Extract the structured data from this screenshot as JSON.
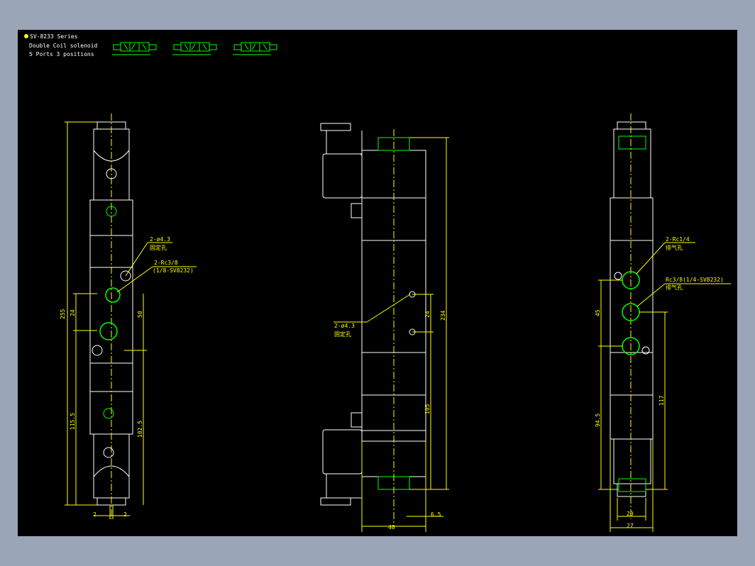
{
  "header": {
    "title": "SV-8233 Series",
    "line2": "Double Coil solenoid",
    "line3": "5 Ports 3 positions",
    "bullet_color": "#ffff00"
  },
  "colors": {
    "body_outline": "#ffffff",
    "dimension": "#ffff00",
    "port_circle": "#00ff00",
    "background": "#000000",
    "frame": "#9aa6b8"
  },
  "left_view": {
    "callout_mount": "2-ø4.3",
    "callout_mount_cn": "固定孔",
    "callout_port": "2-Rc3/8",
    "callout_port_sub": "(1/8-SV8232)",
    "dims": {
      "overall": "255",
      "d24": "24",
      "d50": "50",
      "d115": "115.5",
      "d102": "102.5",
      "d2a": "2",
      "d2b": "2"
    }
  },
  "mid_view": {
    "callout_mount": "2-ø4.3",
    "callout_mount_cn": "固定孔",
    "dims": {
      "overall": "234",
      "d24": "24",
      "d105": "105",
      "d40": "40",
      "d65": "6.5"
    }
  },
  "right_view": {
    "callout_exhaust": "2-Rc1/4",
    "callout_exhaust_cn": "排气孔",
    "callout_port": "Rc3/8(1/4-SV8232)",
    "callout_port_cn": "排气孔",
    "dims": {
      "d45": "45",
      "d945": "94.5",
      "d117": "117",
      "d20": "20",
      "d27": "27"
    }
  }
}
